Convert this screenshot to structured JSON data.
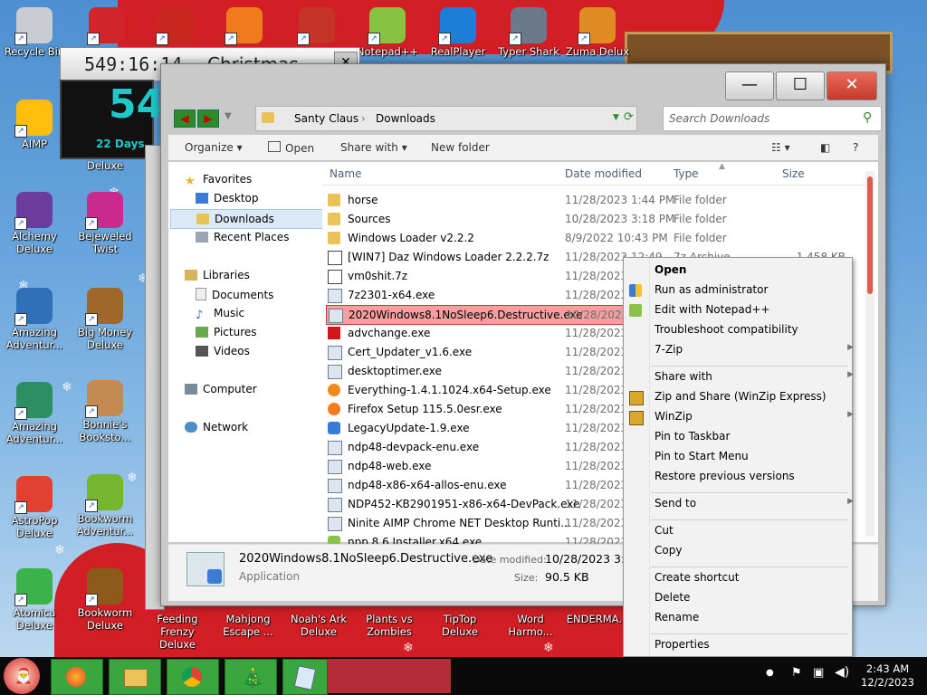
{
  "desktop": {
    "icons_left": [
      {
        "label": "Recycle Bin",
        "color": "#c9ccd2"
      },
      {
        "label": "AIMP",
        "color": "#ffbe0d"
      },
      {
        "label": "Alchemy Deluxe",
        "color": "#6b3b9d"
      },
      {
        "label": "Amazing Adventur...",
        "color": "#2f70b8"
      },
      {
        "label": "Amazing Adventur...",
        "color": "#2b8f61"
      },
      {
        "label": "AstroPop Deluxe",
        "color": "#e14131"
      },
      {
        "label": "Atomica Deluxe",
        "color": "#3bb24a"
      }
    ],
    "icons_col2": [
      {
        "label": "Deluxe",
        "color": "#3a5fbf"
      },
      {
        "label": "Bejeweled Twist",
        "color": "#c82b8d"
      },
      {
        "label": "Big Money Deluxe",
        "color": "#a0662a"
      },
      {
        "label": "Bonnie's Booksto...",
        "color": "#c58a52"
      },
      {
        "label": "Bookworm Adventur...",
        "color": "#75b52f"
      },
      {
        "label": "Bookworm Deluxe",
        "color": "#8c5a1b"
      }
    ],
    "icons_top": [
      {
        "label": "",
        "color": "#d2242b"
      },
      {
        "label": "",
        "color": "#c9261f"
      },
      {
        "label": "",
        "color": "#f07b1c"
      },
      {
        "label": "",
        "color": "#c53425"
      },
      {
        "label": "Notepad++",
        "color": "#86c340"
      },
      {
        "label": "RealPlayer",
        "color": "#1d7ed8"
      },
      {
        "label": "Typer Shark",
        "color": "#6a7a8a"
      },
      {
        "label": "Zuma Delux",
        "color": "#e08c23"
      }
    ],
    "icons_bottom": [
      {
        "label": "Feeding Frenzy Deluxe"
      },
      {
        "label": "Mahjong Escape ..."
      },
      {
        "label": "Noah's Ark Deluxe"
      },
      {
        "label": "Plants vs Zombies"
      },
      {
        "label": "TipTop Deluxe"
      },
      {
        "label": "Word Harmo..."
      },
      {
        "label": "ENDERMA..."
      }
    ],
    "gadget": {
      "timer": "549:16:14",
      "title": "Christmas",
      "big_number": "54",
      "days": "22 Days"
    }
  },
  "explorer": {
    "breadcrumb": [
      "Santy Claus",
      "Downloads"
    ],
    "search_placeholder": "Search Downloads",
    "toolbar": {
      "organize": "Organize",
      "open": "Open",
      "share_with": "Share with",
      "new_folder": "New folder"
    },
    "nav": {
      "favorites": "Favorites",
      "desktop": "Desktop",
      "downloads": "Downloads",
      "recent": "Recent Places",
      "libraries": "Libraries",
      "documents": "Documents",
      "music": "Music",
      "pictures": "Pictures",
      "videos": "Videos",
      "computer": "Computer",
      "network": "Network"
    },
    "columns": {
      "name": "Name",
      "date": "Date modified",
      "type": "Type",
      "size": "Size"
    },
    "files": [
      {
        "name": "horse",
        "date": "11/28/2023 1:44 PM",
        "type": "File folder",
        "size": "",
        "icon": "folder"
      },
      {
        "name": "Sources",
        "date": "10/28/2023 3:18 PM",
        "type": "File folder",
        "size": "",
        "icon": "folder"
      },
      {
        "name": "Windows Loader v2.2.2",
        "date": "8/9/2022 10:43 PM",
        "type": "File folder",
        "size": "",
        "icon": "folder"
      },
      {
        "name": "[WIN7] Daz Windows Loader 2.2.2.7z",
        "date": "11/28/2023 12:49",
        "type": "7z Archive",
        "size": "1,458 KB",
        "icon": "archive"
      },
      {
        "name": "vm0shit.7z",
        "date": "11/28/2023 2",
        "type": "",
        "size": "",
        "icon": "archive"
      },
      {
        "name": "7z2301-x64.exe",
        "date": "11/28/2023 1",
        "type": "",
        "size": "",
        "icon": "exe"
      },
      {
        "name": "2020Windows8.1NoSleep6.Destructive.exe",
        "date": "10/28/2023 3",
        "type": "",
        "size": "",
        "icon": "exe"
      },
      {
        "name": "advchange.exe",
        "date": "11/28/2023 1",
        "type": "",
        "size": "",
        "icon": "acrobat"
      },
      {
        "name": "Cert_Updater_v1.6.exe",
        "date": "11/28/2023 1",
        "type": "",
        "size": "",
        "icon": "exe"
      },
      {
        "name": "desktoptimer.exe",
        "date": "11/28/2023 1",
        "type": "",
        "size": "",
        "icon": "exe"
      },
      {
        "name": "Everything-1.4.1.1024.x64-Setup.exe",
        "date": "11/28/2023 1",
        "type": "",
        "size": "",
        "icon": "search"
      },
      {
        "name": "Firefox Setup 115.5.0esr.exe",
        "date": "11/28/2023 1",
        "type": "",
        "size": "",
        "icon": "firefox"
      },
      {
        "name": "LegacyUpdate-1.9.exe",
        "date": "11/28/2023 1",
        "type": "",
        "size": "",
        "icon": "shield"
      },
      {
        "name": "ndp48-devpack-enu.exe",
        "date": "11/28/2023 1",
        "type": "",
        "size": "",
        "icon": "exe"
      },
      {
        "name": "ndp48-web.exe",
        "date": "11/28/2023 1",
        "type": "",
        "size": "",
        "icon": "exe"
      },
      {
        "name": "ndp48-x86-x64-allos-enu.exe",
        "date": "11/28/2023 1",
        "type": "",
        "size": "",
        "icon": "exe"
      },
      {
        "name": "NDP452-KB2901951-x86-x64-DevPack.exe",
        "date": "11/28/2023 1",
        "type": "",
        "size": "",
        "icon": "exe"
      },
      {
        "name": "Ninite AIMP Chrome NET Desktop Runti...",
        "date": "11/28/2023 1",
        "type": "",
        "size": "",
        "icon": "exe"
      },
      {
        "name": "npp.8.6.Installer.x64.exe",
        "date": "11/28/2023 1",
        "type": "",
        "size": "",
        "icon": "npp"
      }
    ],
    "selected_index": 6,
    "details": {
      "filename": "2020Windows8.1NoSleep6.Destructive.exe",
      "kind": "Application",
      "date_label": "Date modified:",
      "date_value": "10/28/2023 3:13",
      "size_label": "Size:",
      "size_value": "90.5 KB"
    }
  },
  "context_menu": {
    "items": [
      {
        "label": "Open",
        "bold": true,
        "submenu": false,
        "icon": ""
      },
      {
        "label": "Run as administrator",
        "bold": false,
        "submenu": false,
        "icon": "shield"
      },
      {
        "label": "Edit with Notepad++",
        "bold": false,
        "submenu": false,
        "icon": "notepad"
      },
      {
        "label": "Troubleshoot compatibility",
        "bold": false,
        "submenu": false,
        "icon": ""
      },
      {
        "label": "7-Zip",
        "bold": false,
        "submenu": true,
        "icon": ""
      },
      {
        "sep": true
      },
      {
        "label": "Share with",
        "bold": false,
        "submenu": true,
        "icon": ""
      },
      {
        "label": "Zip and Share (WinZip Express)",
        "bold": false,
        "submenu": false,
        "icon": "winzip"
      },
      {
        "label": "WinZip",
        "bold": false,
        "submenu": true,
        "icon": "winzip"
      },
      {
        "label": "Pin to Taskbar",
        "bold": false,
        "submenu": false,
        "icon": ""
      },
      {
        "label": "Pin to Start Menu",
        "bold": false,
        "submenu": false,
        "icon": ""
      },
      {
        "label": "Restore previous versions",
        "bold": false,
        "submenu": false,
        "icon": ""
      },
      {
        "sep": true
      },
      {
        "label": "Send to",
        "bold": false,
        "submenu": true,
        "icon": ""
      },
      {
        "sep": true
      },
      {
        "label": "Cut",
        "bold": false,
        "submenu": false,
        "icon": ""
      },
      {
        "label": "Copy",
        "bold": false,
        "submenu": false,
        "icon": ""
      },
      {
        "sep": true
      },
      {
        "label": "Create shortcut",
        "bold": false,
        "submenu": false,
        "icon": ""
      },
      {
        "label": "Delete",
        "bold": false,
        "submenu": false,
        "icon": ""
      },
      {
        "label": "Rename",
        "bold": false,
        "submenu": false,
        "icon": ""
      },
      {
        "sep": true
      },
      {
        "label": "Properties",
        "bold": false,
        "submenu": false,
        "icon": ""
      }
    ]
  },
  "taskbar": {
    "time": "2:43 AM",
    "date": "12/2/2023",
    "apps": [
      {
        "name": "firefox-icon"
      },
      {
        "name": "explorer-icon"
      },
      {
        "name": "chrome-icon"
      },
      {
        "name": "christmas-tree-icon"
      },
      {
        "name": "notepad-icon"
      }
    ]
  },
  "colors": {
    "accent_selection": "#f2a0a0",
    "taskbar_green": "#39a63e",
    "santa_red": "#d21f25"
  }
}
